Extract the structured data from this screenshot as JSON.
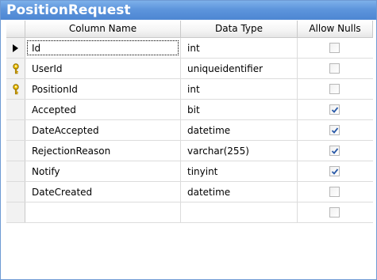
{
  "window": {
    "title": "PositionRequest"
  },
  "grid": {
    "headers": {
      "name": "Column Name",
      "type": "Data Type",
      "nulls": "Allow Nulls"
    },
    "rows": [
      {
        "name": "Id",
        "type": "int",
        "allow_nulls": false,
        "marker": "current-row-arrow-icon"
      },
      {
        "name": "UserId",
        "type": "uniqueidentifier",
        "allow_nulls": false,
        "marker": "primary-key-icon"
      },
      {
        "name": "PositionId",
        "type": "int",
        "allow_nulls": false,
        "marker": "primary-key-icon"
      },
      {
        "name": "Accepted",
        "type": "bit",
        "allow_nulls": true
      },
      {
        "name": "DateAccepted",
        "type": "datetime",
        "allow_nulls": true
      },
      {
        "name": "RejectionReason",
        "type": "varchar(255)",
        "allow_nulls": true
      },
      {
        "name": "Notify",
        "type": "tinyint",
        "allow_nulls": true
      },
      {
        "name": "DateCreated",
        "type": "datetime",
        "allow_nulls": false
      },
      {
        "name": "",
        "type": "",
        "allow_nulls": false
      }
    ]
  },
  "colors": {
    "title_bar": "#5d95dc",
    "title_text": "#ffffff",
    "check_mark": "#2a5aa8",
    "key_gold": "#d9a400"
  }
}
